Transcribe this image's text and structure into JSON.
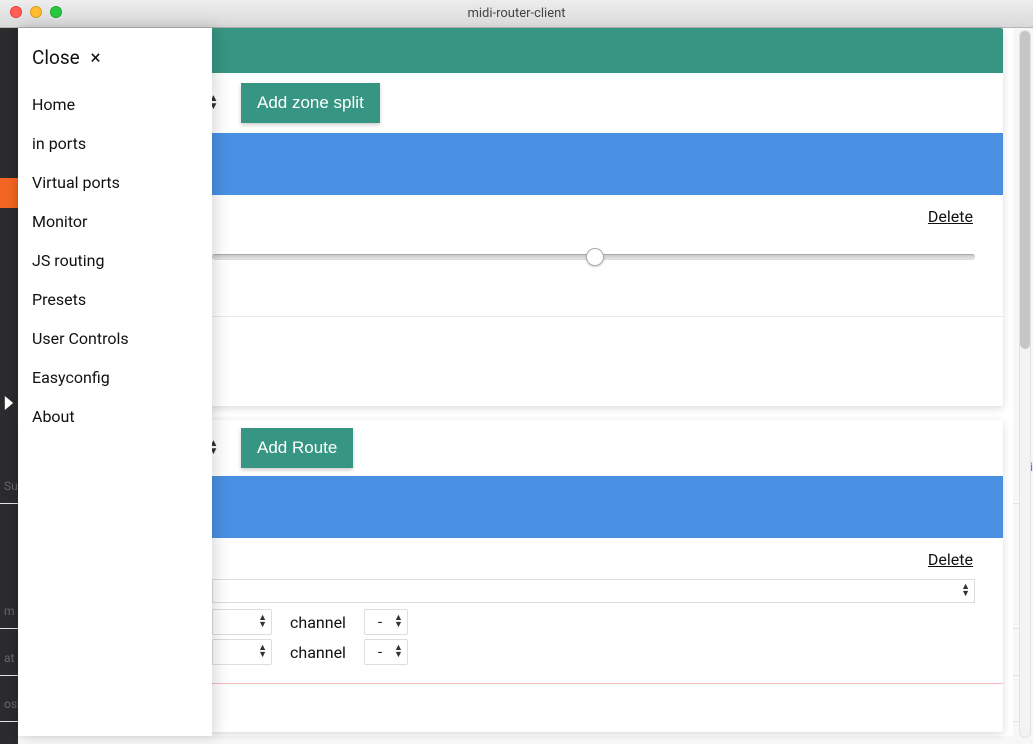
{
  "window": {
    "title": "midi-router-client"
  },
  "sidebar": {
    "close_label": "Close",
    "close_glyph": "×",
    "items": [
      {
        "label": "Home"
      },
      {
        "label": "in ports"
      },
      {
        "label": "Virtual ports"
      },
      {
        "label": "Monitor"
      },
      {
        "label": "JS routing"
      },
      {
        "label": "Presets"
      },
      {
        "label": "User Controls"
      },
      {
        "label": "Easyconfig"
      },
      {
        "label": "About"
      }
    ]
  },
  "zone": {
    "add_label": "Add zone split",
    "delete_label": "Delete",
    "slider_value": 49
  },
  "route": {
    "add_label": "Add Route",
    "delete_label": "Delete",
    "dest_value": "",
    "row1": {
      "channel_label": "channel",
      "value": "-"
    },
    "row2": {
      "channel_label": "channel",
      "value": "-"
    }
  },
  "bg": {
    "sun": "Sun",
    "m": "m",
    "at": "at",
    "osh": "osh",
    "hi": "hi"
  }
}
